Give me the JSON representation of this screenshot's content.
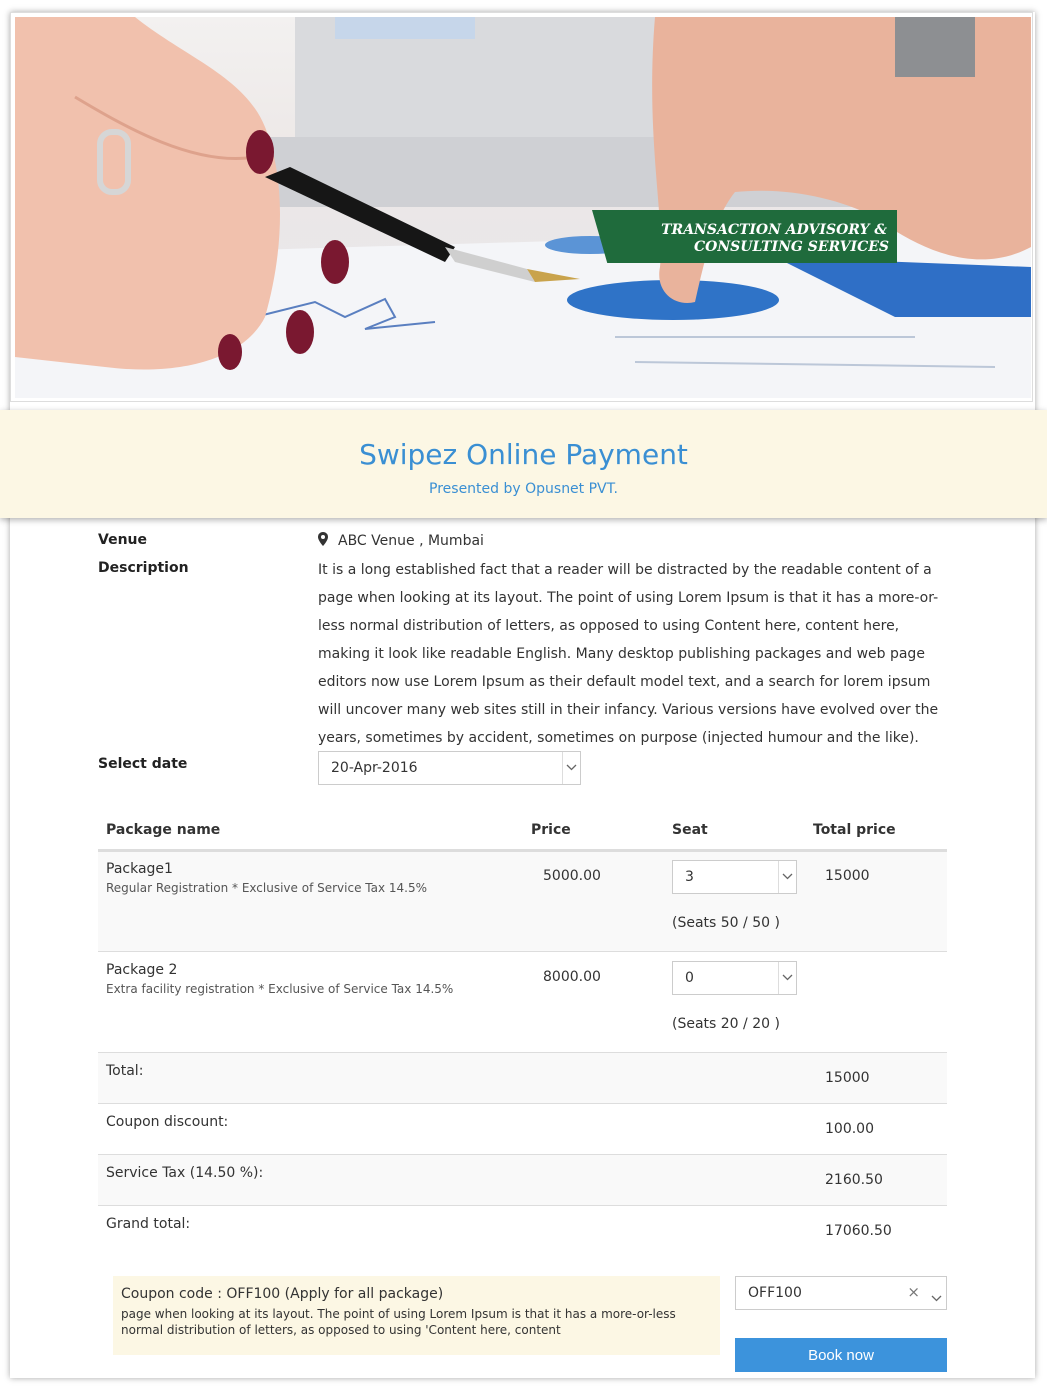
{
  "banner": {
    "tagline_line1": "TRANSACTION ADVISORY &",
    "tagline_line2": "CONSULTING SERVICES"
  },
  "header": {
    "title": "Swipez Online Payment",
    "subtitle": "Presented by Opusnet PVT."
  },
  "event": {
    "venue_label": "Venue",
    "venue_value": "ABC Venue , Mumbai",
    "description_label": "Description",
    "description_value": "It is a long established fact that a reader will be distracted by the readable content of a page when looking at its layout. The point of using Lorem Ipsum is that it has a more-or-less normal distribution of letters, as opposed to using Content here, content here, making it look like readable English. Many desktop publishing packages and web page editors now use Lorem Ipsum as their default model text, and a search for lorem ipsum will uncover many web sites still in their infancy. Various versions have evolved over the years, sometimes by accident, sometimes on purpose (injected humour and the like).",
    "date_label": "Select date",
    "date_value": "20-Apr-2016"
  },
  "packages": {
    "headers": {
      "name": "Package name",
      "price": "Price",
      "seat": "Seat",
      "total": "Total price"
    },
    "rows": [
      {
        "name": "Package1",
        "note": "Regular Registration * Exclusive of Service Tax 14.5%",
        "price": "5000.00",
        "seat_value": "3",
        "seats_info": "(Seats 50 / 50 )",
        "total": "15000"
      },
      {
        "name": "Package 2",
        "note": "Extra facility registration * Exclusive of Service Tax 14.5%",
        "price": "8000.00",
        "seat_value": "0",
        "seats_info": "(Seats 20 / 20 )",
        "total": ""
      }
    ]
  },
  "summary": {
    "total_label": "Total:",
    "total_value": "15000",
    "coupon_label": "Coupon discount:",
    "coupon_value": "100.00",
    "tax_label": "Service Tax (14.50 %):",
    "tax_value": "2160.50",
    "grand_label": "Grand total:",
    "grand_value": "17060.50"
  },
  "coupon": {
    "heading": "Coupon code : OFF100 (Apply for all package)",
    "text": "page when looking at its layout. The point of using Lorem Ipsum is that it has a more-or-less normal distribution of letters, as opposed to using 'Content here, content",
    "selected": "OFF100",
    "clear_symbol": "×"
  },
  "actions": {
    "book_label": "Book now"
  },
  "colors": {
    "accent": "#3a8fd3",
    "button": "#3c93dc",
    "band": "#fcf7e4",
    "tag_green": "#1f6b3c"
  }
}
